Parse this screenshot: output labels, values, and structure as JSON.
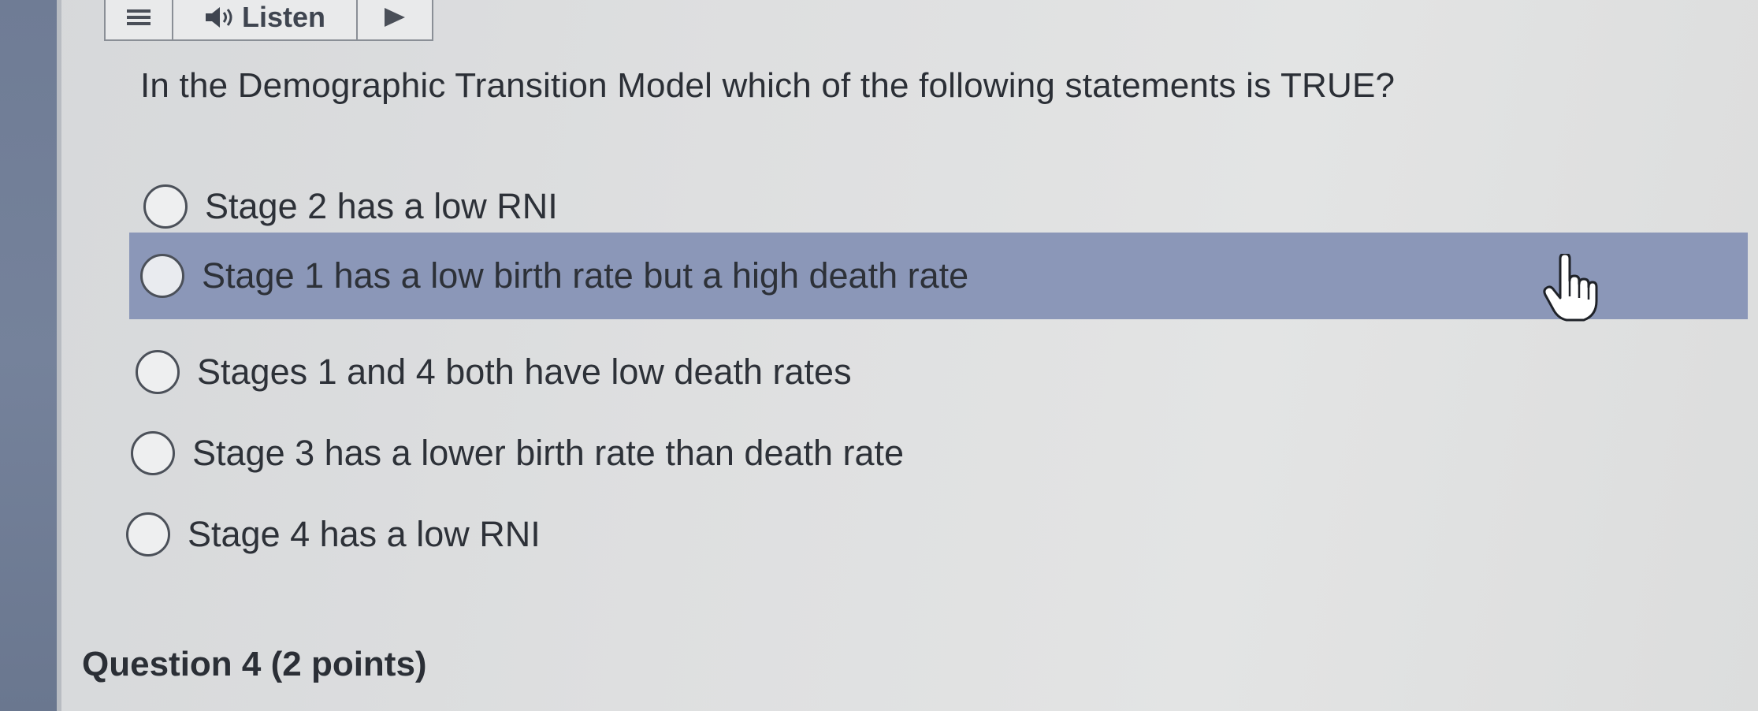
{
  "toolbar": {
    "menu_icon": "hamburger-menu-icon",
    "listen_label": "Listen",
    "speaker_icon": "speaker-icon",
    "play_icon": "play-triangle-icon"
  },
  "question": {
    "text": "In the Demographic Transition Model which of the following statements is TRUE?"
  },
  "options": [
    {
      "label": "Stage 2 has a low RNI",
      "selected": false,
      "hovered": false
    },
    {
      "label": "Stage 1 has a low birth rate but a high death rate",
      "selected": false,
      "hovered": true
    },
    {
      "label": "Stages 1 and 4 both have low death rates",
      "selected": false,
      "hovered": false
    },
    {
      "label": "Stage 3 has a lower birth rate than death rate",
      "selected": false,
      "hovered": false
    },
    {
      "label": "Stage 4 has a low RNI",
      "selected": false,
      "hovered": false
    }
  ],
  "next_question": {
    "title": "Question 4 (2 points)"
  },
  "colors": {
    "hover_highlight": "#8b97b8",
    "sidebar": "#717e97",
    "text": "#2b2f36"
  }
}
